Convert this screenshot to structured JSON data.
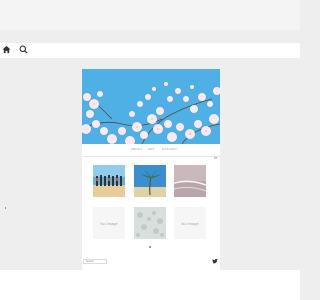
{
  "header": {
    "home_icon": "home-icon",
    "search_icon": "search-icon"
  },
  "hero": {
    "image_subject": "cherry blossoms against blue sky",
    "sky_color": "#4fb0e6"
  },
  "menu": {
    "items": [
      {
        "label": "ABOUT"
      },
      {
        "label": "ART"
      },
      {
        "label": "GALLERY"
      }
    ]
  },
  "gallery": {
    "view_toggle": "▪▪",
    "items": [
      {
        "kind": "image",
        "subject": "people standing on beach"
      },
      {
        "kind": "image",
        "subject": "palm tree beach"
      },
      {
        "kind": "image",
        "subject": "sea shore with waves"
      },
      {
        "kind": "placeholder",
        "label": "No Image"
      },
      {
        "kind": "image",
        "subject": "faded snowy landscape"
      },
      {
        "kind": "placeholder",
        "label": "No Image"
      }
    ]
  },
  "footer": {
    "input_value": "Search",
    "social_icon": "twitter-icon"
  }
}
